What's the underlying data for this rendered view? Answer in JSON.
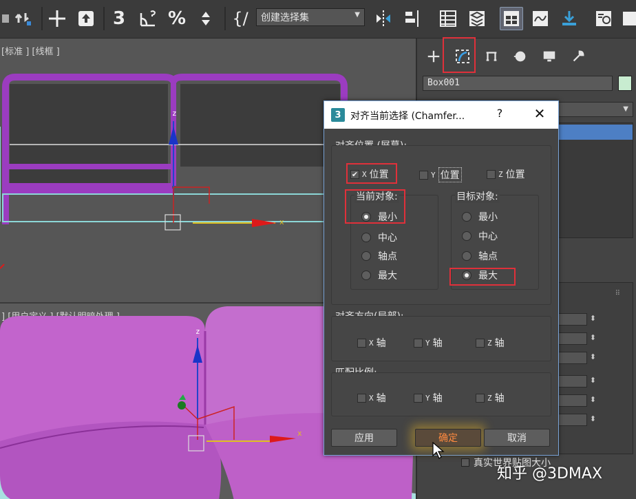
{
  "toolbar": {
    "selection_set": "创建选择集",
    "snap_label": "3"
  },
  "viewport_top": {
    "label": "[标准 ] [线框 ]",
    "gizmo_z": "z",
    "gizmo_x": "x"
  },
  "viewport_bottom": {
    "label": "] [用户定义 ] [默认明暗处理 ]"
  },
  "command_panel": {
    "object_name": "Box001",
    "object_color": "#c8ecd0",
    "real_world_map_size": "真实世界贴图大小"
  },
  "dialog": {
    "icon_glyph": "3",
    "title": "对齐当前选择 (Chamfer...",
    "help": "?",
    "close": "✕",
    "align_position_label": "对齐位置 (屏幕):",
    "x_position": {
      "axis": "X",
      "label": "位置",
      "checked": true
    },
    "y_position": {
      "axis": "Y",
      "label": "位置",
      "checked": false
    },
    "z_position": {
      "axis": "Z",
      "label": "位置",
      "checked": false
    },
    "current_object_label": "当前对象:",
    "target_object_label": "目标对象:",
    "current_options": [
      "最小",
      "中心",
      "轴点",
      "最大"
    ],
    "current_selected": "最小",
    "target_options": [
      "最小",
      "中心",
      "轴点",
      "最大"
    ],
    "target_selected": "最大",
    "orientation_label": "对齐方向(局部):",
    "orientation_axes": [
      {
        "axis": "X",
        "label": "轴"
      },
      {
        "axis": "Y",
        "label": "轴"
      },
      {
        "axis": "Z",
        "label": "轴"
      }
    ],
    "scale_label": "匹配比例:",
    "scale_axes": [
      {
        "axis": "X",
        "label": "轴"
      },
      {
        "axis": "Y",
        "label": "轴"
      },
      {
        "axis": "Z",
        "label": "轴"
      }
    ],
    "apply_label": "应用",
    "ok_label": "确定",
    "cancel_label": "取消"
  },
  "colors": {
    "highlight": "#e0303a",
    "viewport_object": "#9b3cc0",
    "sofa": "#c060c8",
    "selection_blue": "#4d7fc4"
  },
  "watermark": "知乎 @3DMAX"
}
